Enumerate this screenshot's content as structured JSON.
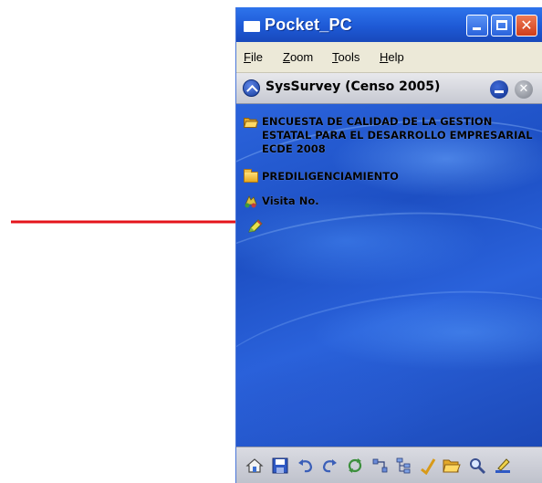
{
  "window": {
    "title": "Pocket_PC",
    "controls": {
      "minimize": "minimize-icon",
      "maximize": "maximize-icon",
      "close": "close-icon",
      "close_glyph": "✕"
    }
  },
  "menu": {
    "items": [
      {
        "label": "File"
      },
      {
        "label": "Zoom"
      },
      {
        "label": "Tools"
      },
      {
        "label": "Help"
      }
    ]
  },
  "app_header": {
    "title": "SysSurvey (Censo 2005)",
    "close_glyph": "✕"
  },
  "tree": {
    "items": [
      {
        "label": "ENCUESTA DE CALIDAD DE LA GESTION ESTATAL PARA EL DESARROLLO EMPRESARIAL ECDE 2008",
        "icon": "folder-open-icon"
      },
      {
        "label": "PREDILIGENCIAMIENTO",
        "icon": "folder-icon"
      },
      {
        "label": "Visita No.",
        "icon": "visit-icon"
      },
      {
        "label": "",
        "icon": "pencil-icon"
      }
    ]
  },
  "toolbar": {
    "icons": [
      "home-icon",
      "save-icon",
      "undo-icon",
      "redo-icon",
      "sync-icon",
      "network-icon",
      "tree-icon",
      "check-icon",
      "open-folder-icon",
      "search-icon",
      "edit-icon"
    ]
  },
  "colors": {
    "window_blue": "#1f53c8",
    "title_blue": "#1e5ad6",
    "menu_bg": "#ece9d8",
    "annotation_red": "#e4141b"
  }
}
